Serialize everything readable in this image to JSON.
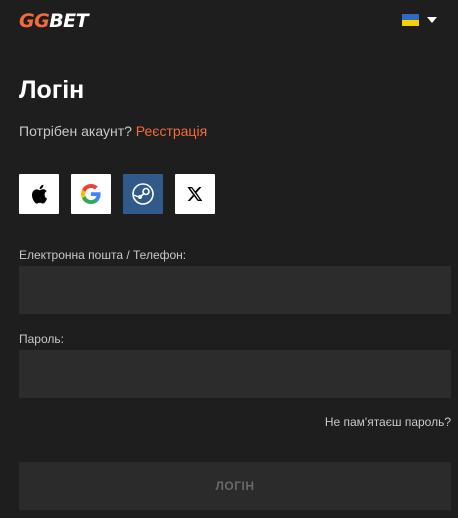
{
  "header": {
    "logo_part1": "GG",
    "logo_part2": "BET",
    "language": {
      "flag_icon": "ukraine-flag-icon",
      "caret_icon": "chevron-down-icon"
    }
  },
  "login": {
    "title": "Логін",
    "register_prompt": "Потрібен акаунт?",
    "register_link": "Реєстрація",
    "social_buttons": [
      {
        "icon": "apple-icon"
      },
      {
        "icon": "google-icon"
      },
      {
        "icon": "steam-icon"
      },
      {
        "icon": "x-icon"
      }
    ],
    "email_label": "Електронна пошта / Телефон:",
    "email_value": "",
    "password_label": "Пароль:",
    "password_value": "",
    "forgot_link": "Не пам'ятаєш пароль?",
    "submit_label": "ЛОГІН"
  },
  "colors": {
    "background": "#1e1e1e",
    "accent": "#f46b3b",
    "field": "#2c2c2c",
    "steam": "#2f5a8a"
  }
}
